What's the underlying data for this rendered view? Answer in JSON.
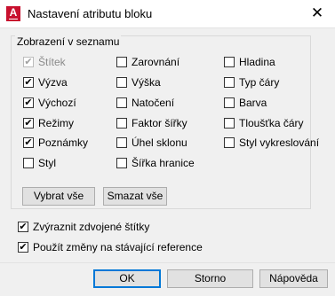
{
  "window": {
    "title": "Nastavení atributu bloku",
    "close_glyph": "✕",
    "app_icon": "A"
  },
  "group": {
    "label": "Zobrazení v seznamu"
  },
  "checkboxes": [
    {
      "label": "Štítek",
      "checked": true,
      "disabled": true
    },
    {
      "label": "Výzva",
      "checked": true,
      "disabled": false
    },
    {
      "label": "Výchozí",
      "checked": true,
      "disabled": false
    },
    {
      "label": "Režimy",
      "checked": true,
      "disabled": false
    },
    {
      "label": "Poznámky",
      "checked": true,
      "disabled": false
    },
    {
      "label": "Styl",
      "checked": false,
      "disabled": false
    },
    {
      "label": "Zarovnání",
      "checked": false,
      "disabled": false
    },
    {
      "label": "Výška",
      "checked": false,
      "disabled": false
    },
    {
      "label": "Natočení",
      "checked": false,
      "disabled": false
    },
    {
      "label": "Faktor šířky",
      "checked": false,
      "disabled": false
    },
    {
      "label": "Úhel sklonu",
      "checked": false,
      "disabled": false
    },
    {
      "label": "Šířka hranice",
      "checked": false,
      "disabled": false
    },
    {
      "label": "Hladina",
      "checked": false,
      "disabled": false
    },
    {
      "label": "Typ čáry",
      "checked": false,
      "disabled": false
    },
    {
      "label": "Barva",
      "checked": false,
      "disabled": false
    },
    {
      "label": "Tloušťka čáry",
      "checked": false,
      "disabled": false
    },
    {
      "label": "Styl vykreslování",
      "checked": false,
      "disabled": false
    }
  ],
  "group_buttons": {
    "select_all": "Vybrat vše",
    "clear_all": "Smazat vše"
  },
  "options": [
    {
      "label": "Zvýraznit zdvojené štítky",
      "checked": true
    },
    {
      "label": "Použít změny na stávající reference",
      "checked": true
    }
  ],
  "footer": {
    "ok": "OK",
    "cancel": "Storno",
    "help": "Nápověda"
  },
  "check_glyph": "✔",
  "colors": {
    "accent": "#0078d7",
    "app_icon": "#c8102e"
  }
}
